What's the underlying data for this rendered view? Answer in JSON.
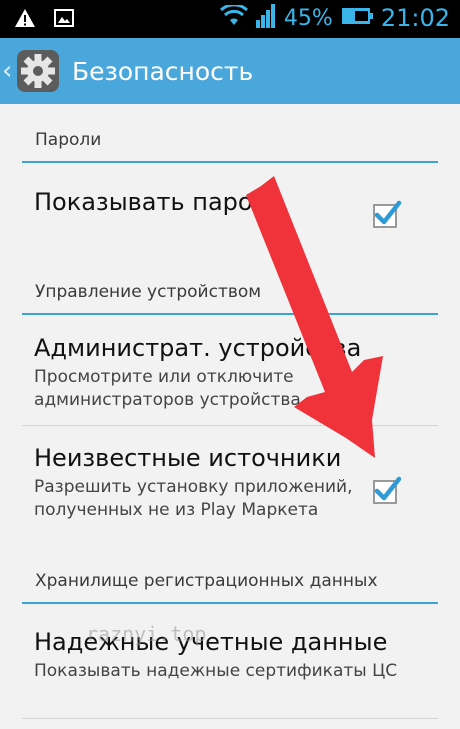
{
  "status_bar": {
    "battery_percent": "45%",
    "time": "21:02"
  },
  "action_bar": {
    "title": "Безопасность",
    "icon": "settings-gear-icon"
  },
  "sections": {
    "passwords": {
      "header": "Пароли",
      "show_passwords": {
        "title": "Показывать пароли",
        "checked": true
      }
    },
    "device_admin": {
      "header": "Управление устройством",
      "admins": {
        "title": "Администрат. устройства",
        "summary": "Просмотрите или отключите администраторов устройства"
      },
      "unknown_sources": {
        "title": "Неизвестные источники",
        "summary": "Разрешить установку приложений, полученных не из Play Маркета",
        "checked": true
      }
    },
    "credential_storage": {
      "header": "Хранилище регистрационных данных",
      "trusted_credentials": {
        "title": "Надежные учетные данные",
        "summary": "Показывать надежные сертификаты ЦС"
      }
    }
  },
  "overlay": {
    "watermark": "raznyi.top",
    "arrow_color": "#f0323a"
  },
  "colors": {
    "action_bar": "#4aa7dc",
    "accent": "#3aa4da",
    "status_bar": "#000000"
  }
}
